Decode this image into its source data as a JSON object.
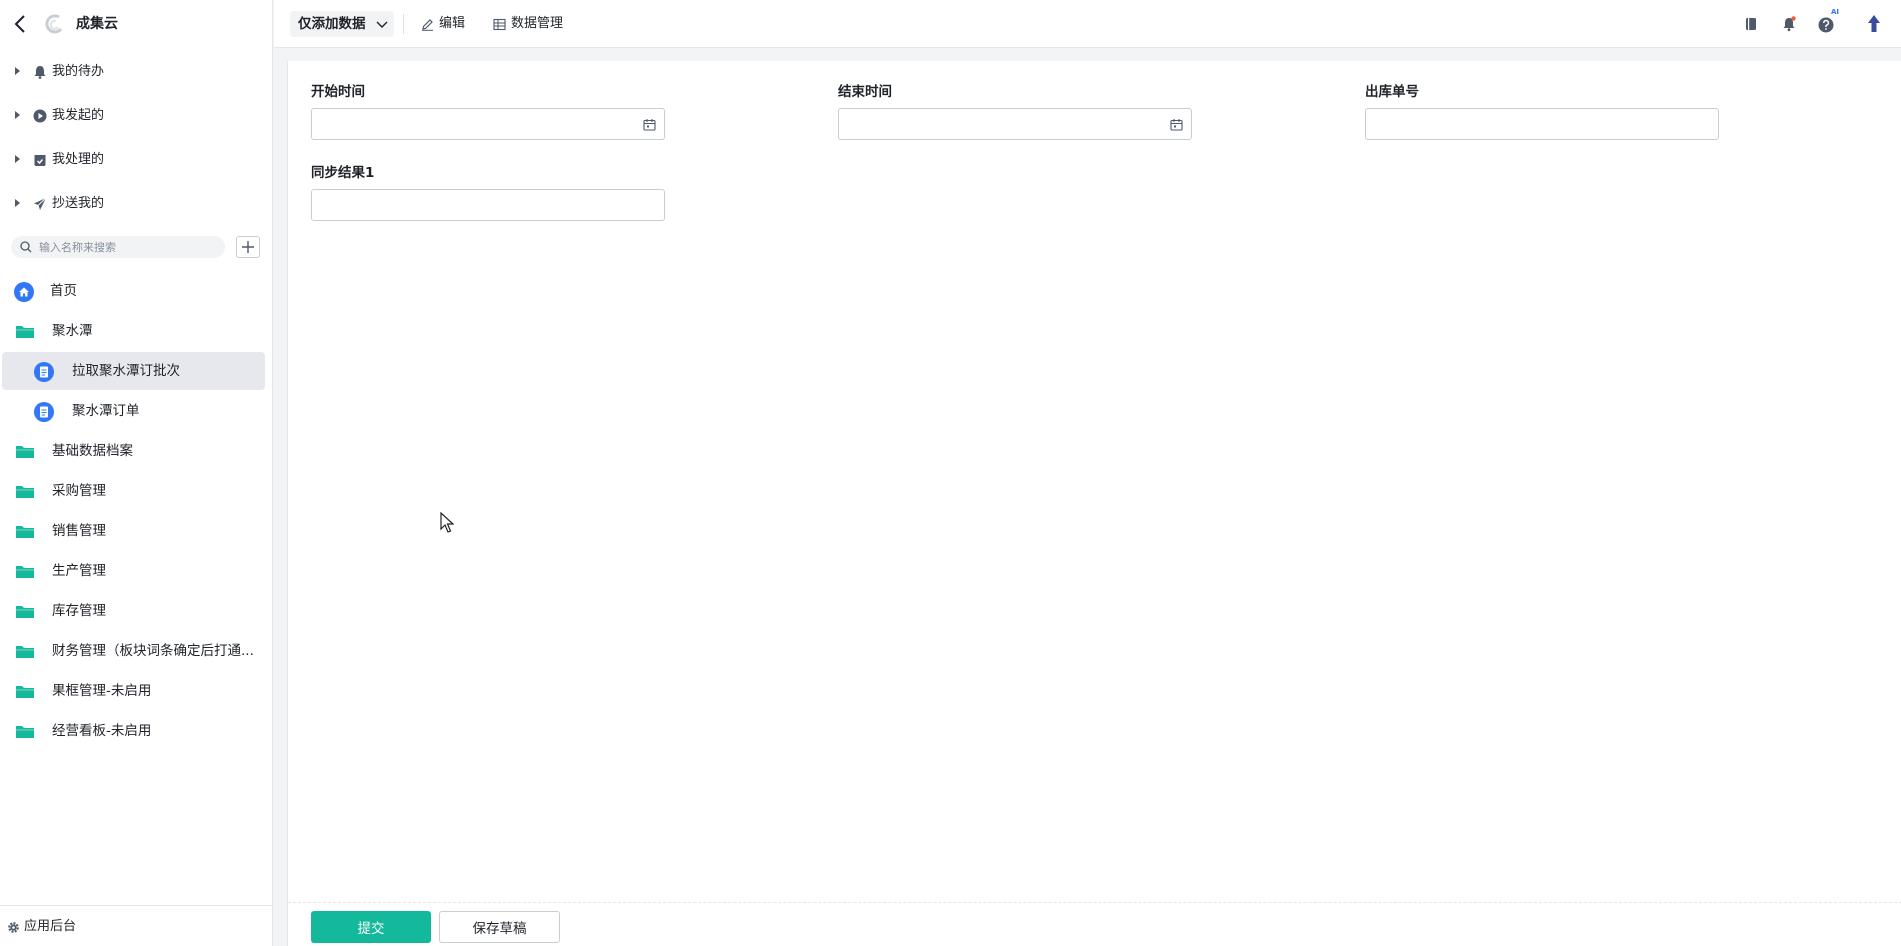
{
  "app": {
    "title": "成集云"
  },
  "colors": {
    "accent": "#14b89a",
    "nav_blue": "#3277f5",
    "folder_green": "#14b89a"
  },
  "sidebar": {
    "flows": [
      {
        "label": "我的待办",
        "icon": "bell-icon"
      },
      {
        "label": "我发起的",
        "icon": "play-circle-icon"
      },
      {
        "label": "我处理的",
        "icon": "inbox-check-icon"
      },
      {
        "label": "抄送我的",
        "icon": "paper-plane-icon"
      }
    ],
    "search": {
      "placeholder": "输入名称来搜索"
    },
    "nav": [
      {
        "label": "首页",
        "icon": "home-icon"
      },
      {
        "label": "聚水潭",
        "icon": "folder-icon"
      },
      {
        "label": "拉取聚水潭订批次",
        "icon": "form-icon",
        "active": true
      },
      {
        "label": "聚水潭订单",
        "icon": "form-icon"
      },
      {
        "label": "基础数据档案",
        "icon": "folder-icon"
      },
      {
        "label": "采购管理",
        "icon": "folder-icon"
      },
      {
        "label": "销售管理",
        "icon": "folder-icon"
      },
      {
        "label": "生产管理",
        "icon": "folder-icon"
      },
      {
        "label": "库存管理",
        "icon": "folder-icon"
      },
      {
        "label": "财务管理（板块词条确定后打通...",
        "icon": "folder-icon"
      },
      {
        "label": "果框管理-未启用",
        "icon": "folder-icon"
      },
      {
        "label": "经营看板-未启用",
        "icon": "folder-icon"
      }
    ],
    "footer": {
      "label": "应用后台"
    }
  },
  "toolbar": {
    "mode": "仅添加数据",
    "edit": "编辑",
    "data_manage": "数据管理",
    "ai_badge": "AI"
  },
  "form": {
    "fields": [
      {
        "label": "开始时间",
        "type": "date",
        "value": ""
      },
      {
        "label": "结束时间",
        "type": "date",
        "value": ""
      },
      {
        "label": "出库单号",
        "type": "text",
        "value": ""
      },
      {
        "label": "同步结果1",
        "type": "text",
        "value": ""
      }
    ],
    "submit": "提交",
    "save_draft": "保存草稿"
  }
}
